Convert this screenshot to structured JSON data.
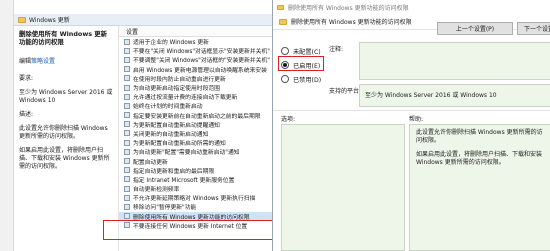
{
  "editor": {
    "header_title": "Windows 更新",
    "policy_title": "删除使用所有 Windows 更新功能的访问权限",
    "edit_prefix": "编辑",
    "edit_link": "策略设置",
    "req_label": "要求:",
    "req_text": "至少为 Windows Server 2016 或 Windows 10",
    "desc_label": "描述:",
    "desc_text": "此设置允许你删除扫描 Windows 更新所需的访问权限。",
    "desc_text2": "如果启用此设置，将删除用户扫描、下载和安装 Windows 更新所需的访问权限。",
    "column_header": "设置",
    "settings": [
      "适用于企业的 Windows 更新",
      "不要在\"关闭 Windows\"对话框显示\"安装更新并关机\"",
      "不要调整\"关闭 Windows\"对话框的\"安装更新并关机\"",
      "启用 Windows 更新电源管理以自动唤醒系统来安装",
      "在使用时段内防止自动重启进行更新",
      "为自动更新启动指定使用时段范围",
      "允许通过按流量计费的连接自动下载更新",
      "始终在计划的时间重新启动",
      "指定要安装更新前在自动重新启动之前的最后期限",
      "为更新配置自动重新启动提醒通知",
      "关闭更新的自动重新启动通知",
      "为更新配置自动重新启动所需的通知",
      "为自动更新\"配置\"需要自动重新启动\"通知",
      "配置自动更新",
      "指定自动更新和重启的最后期限",
      "指定 Intranet Microsoft 更新服务位置",
      "自动更新检测频率",
      "不允许更新延期策略对 Windows 更新执行扫描",
      "移除访问\"暂停更新\"功能",
      "删除使用所有 Windows 更新功能的访问权限",
      "不要连接任何 Windows 更新 Internet 位置"
    ]
  },
  "dialog": {
    "window_title": "删除使用所有 Windows 更新功能的访问权限",
    "subtitle": "删除使用所有 Windows 更新功能的访问权限",
    "prev_button": "上一个设置(P)",
    "next_button": "下一个设置",
    "radio_not_configured": "未配置(C)",
    "radio_enabled": "已启用(E)",
    "radio_disabled": "已禁用(D)",
    "comment_label": "注释:",
    "platform_label": "支持的平台:",
    "platform_text": "至少为 Windows Server 2016 或 Windows 10",
    "options_label": "选项:",
    "help_label": "帮助:",
    "help_line1": "此设置允许你删除扫描 Windows 更新所需的访问权限。",
    "help_line2": "如果启用此设置，将删除用户扫描、下载和安装 Windows 更新所需的访问权限。"
  }
}
